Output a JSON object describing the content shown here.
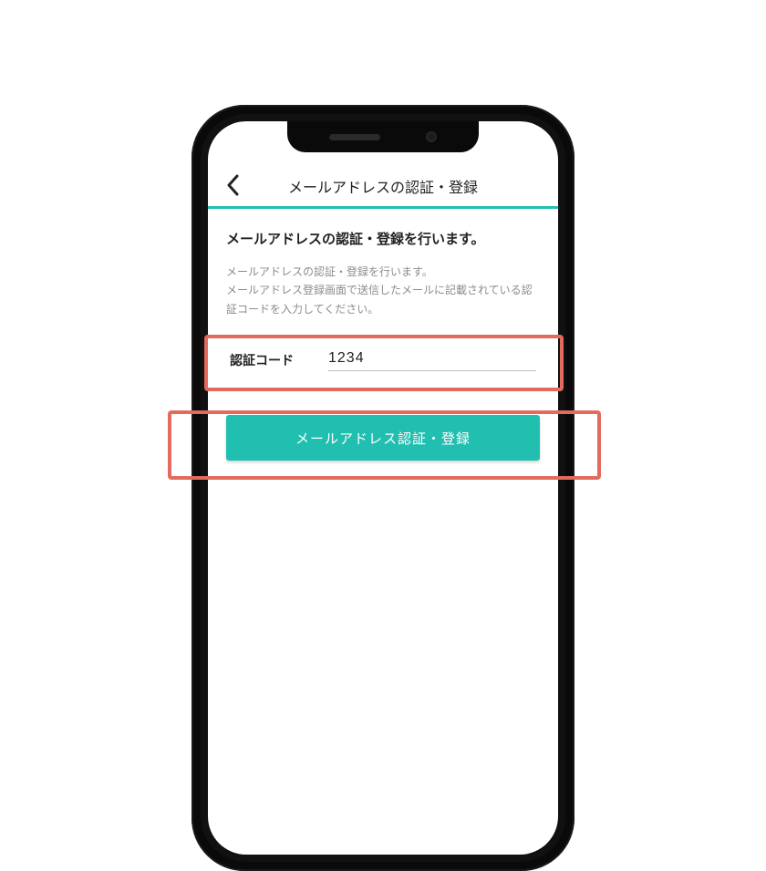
{
  "header": {
    "title": "メールアドレスの認証・登録"
  },
  "body": {
    "section_title": "メールアドレスの認証・登録を行います。",
    "section_desc": "メールアドレスの認証・登録を行います。\nメールアドレス登録画面で送信したメールに記載されている認証コードを入力してください。"
  },
  "code": {
    "label": "認証コード",
    "value": "1234"
  },
  "submit": {
    "label": "メールアドレス認証・登録"
  },
  "colors": {
    "accent": "#1cc1b1",
    "button": "#21bfb0",
    "highlight": "#e46a5e"
  }
}
